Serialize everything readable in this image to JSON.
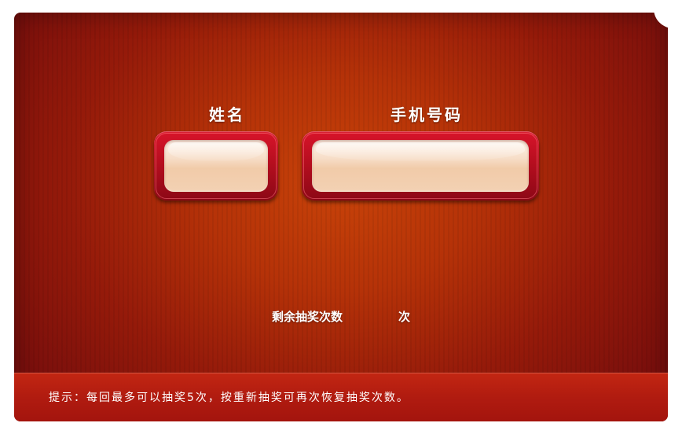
{
  "form": {
    "name_label": "姓名",
    "name_value": "",
    "phone_label": "手机号码",
    "phone_value": ""
  },
  "lottery": {
    "remaining_label": "剩余抽奖次数",
    "remaining_count": "",
    "remaining_unit": "次"
  },
  "footer": {
    "hint": "提示：每回最多可以抽奖5次，按重新抽奖可再次恢复抽奖次数。"
  },
  "colors": {
    "background_center": "#c84309",
    "background_edge": "#7a0f0c",
    "field_frame": "#c8102a",
    "field_fill": "#f5d6bb",
    "footer_bar": "#b01b10",
    "text": "#ffffff"
  }
}
